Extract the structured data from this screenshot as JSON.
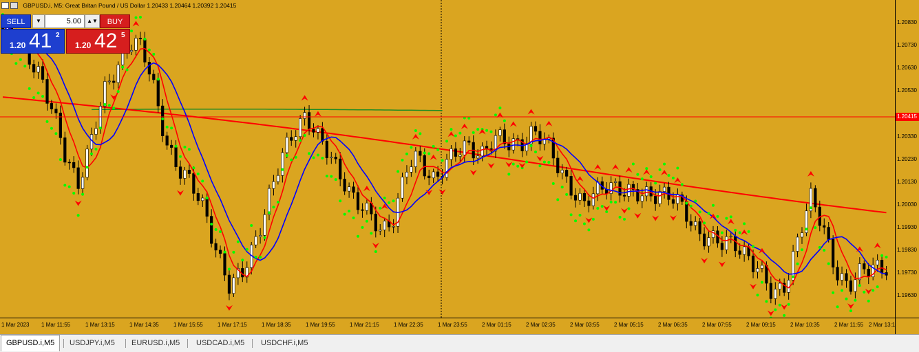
{
  "window": {
    "title": "GBPUSD.i, M5:  Great Britan Pound / US Dollar  1.20433 1.20464 1.20392 1.20415"
  },
  "trade_panel": {
    "sell_label": "SELL",
    "buy_label": "BUY",
    "lot_value": "5.00",
    "sell_quote": {
      "prefix": "1.20",
      "big": "41",
      "sup": "2"
    },
    "buy_quote": {
      "prefix": "1.20",
      "big": "42",
      "sup": "5"
    }
  },
  "price_axis": {
    "labels": [
      "1.20830",
      "1.20730",
      "1.20630",
      "1.20530",
      "1.20330",
      "1.20230",
      "1.20130",
      "1.20030",
      "1.19930",
      "1.19830",
      "1.19730",
      "1.19630"
    ],
    "current_price": "1.20415"
  },
  "time_axis": {
    "labels": [
      "1 Mar 2023",
      "1 Mar 11:55",
      "1 Mar 13:15",
      "1 Mar 14:35",
      "1 Mar 15:55",
      "1 Mar 17:15",
      "1 Mar 18:35",
      "1 Mar 19:55",
      "1 Mar 21:15",
      "1 Mar 22:35",
      "1 Mar 23:55",
      "2 Mar 01:15",
      "2 Mar 02:35",
      "2 Mar 03:55",
      "2 Mar 05:15",
      "2 Mar 06:35",
      "2 Mar 07:55",
      "2 Mar 09:15",
      "2 Mar 10:35",
      "2 Mar 11:55",
      "2 Mar 13:15"
    ]
  },
  "tabs": [
    {
      "label": "GBPUSD.i,M5",
      "active": true
    },
    {
      "label": "USDJPY.i,M5",
      "active": false
    },
    {
      "label": "EURUSD.i,M5",
      "active": false
    },
    {
      "label": "USDCAD.i,M5",
      "active": false
    },
    {
      "label": "USDCHF.i,M5",
      "active": false
    }
  ],
  "colors": {
    "background": "#DAA520",
    "bull_candle": "#000000",
    "bear_candle": "#000000",
    "ma_fast": "#FF0000",
    "ma_slow_blue": "#0000FF",
    "ma_long": "#FF0000",
    "psar": "#00FF00",
    "fractal": "#FF0000",
    "zigzag": "#FF0000",
    "current_price_line": "#FF0000",
    "grid": "#B8860B"
  },
  "icons": [
    "chart-window-icon",
    "chart-properties-icon",
    "dropdown-arrow-icon"
  ],
  "chart_data": {
    "type": "line",
    "symbol": "GBPUSD.i",
    "timeframe": "M5",
    "open": 1.20433,
    "high": 1.20464,
    "low": 1.20392,
    "close": 1.20415,
    "ylim": [
      1.1957,
      1.2088
    ],
    "series": [
      {
        "values": [
          1.2075,
          1.2072,
          1.2066,
          1.2058,
          1.204,
          1.2022,
          1.2014,
          1.203,
          1.2048,
          1.206,
          1.2072,
          1.2068,
          1.205,
          1.203,
          1.2018,
          1.201,
          1.2002,
          1.1985,
          1.1968,
          1.1975,
          1.199,
          1.2005,
          1.202,
          1.2034,
          1.2042,
          1.203,
          1.2022,
          1.2015,
          1.2005,
          1.1998,
          1.1993,
          1.2,
          1.2018,
          1.2022,
          1.2015,
          1.202,
          1.2024,
          1.2028,
          1.2026,
          1.203,
          1.2028,
          1.203,
          1.2034,
          1.2028,
          1.202,
          1.2012,
          1.2002,
          1.2008,
          1.2014,
          1.201,
          1.2006,
          1.2008,
          1.201,
          1.2006,
          1.2,
          1.1994,
          1.199,
          1.1986,
          1.1988,
          1.1984,
          1.1975,
          1.1965,
          1.1972,
          1.199,
          1.2005,
          1.1995,
          1.1978,
          1.1968,
          1.1975,
          1.198,
          1.1978
        ]
      }
    ]
  }
}
